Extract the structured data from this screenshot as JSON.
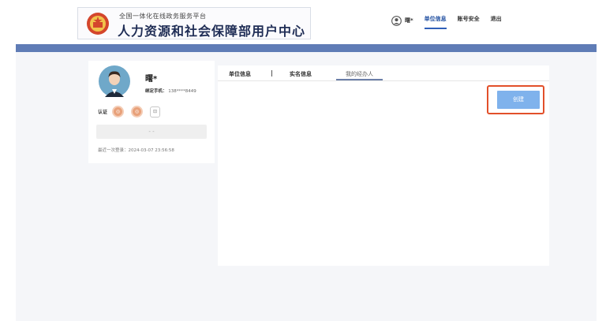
{
  "header": {
    "subtitle": "全国一体化在线政务服务平台",
    "title": "人力资源和社会保障部用户中心",
    "username": "曙*",
    "nav": [
      "单位信息",
      "账号安全",
      "退出"
    ]
  },
  "profile": {
    "name": "曙*",
    "phone_label": "绑定手机：",
    "phone": "138****8449",
    "cert_label": "认证",
    "button_label": "- -",
    "last_login": "最近一次登录：2024-03-07 23:56:58"
  },
  "tabs": [
    "单位信息",
    "实名信息",
    "我的经办人"
  ],
  "actions": {
    "create_label": "创建"
  },
  "colors": {
    "accent_band": "#5f7cb6",
    "create_button": "#7fb2ec",
    "highlight": "#e2502a"
  }
}
